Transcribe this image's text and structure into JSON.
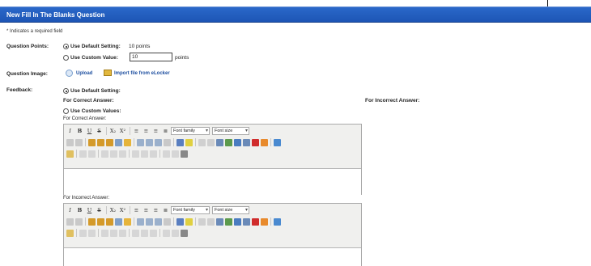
{
  "header": {
    "title": "New Fill In The Blanks Question"
  },
  "required_note": "* Indicates a required field",
  "question_points": {
    "label": "Question Points:",
    "default_label": "Use Default Setting:",
    "default_value": "10 points",
    "custom_label": "Use Custom Value:",
    "custom_value": "10",
    "custom_unit": "points"
  },
  "question_image": {
    "label": "Question Image:",
    "upload": "Upload",
    "import": "Import file from eLocker"
  },
  "feedback": {
    "label": "Feedback:",
    "default_label": "Use Default Setting:",
    "correct_heading": "For Correct Answer:",
    "incorrect_heading": "For Incorrect Answer:",
    "custom_label": "Use Custom Values:",
    "correct_editor_label": "For Correct Answer:",
    "incorrect_editor_label": "For Incorrect Answer:"
  },
  "editor": {
    "bold": "B",
    "italic": "I",
    "underline": "U",
    "strike": "S",
    "sub": "X₂",
    "sup": "X²",
    "font_family": "Font family",
    "font_size": "Font size"
  },
  "colors": {
    "header": "#1d55b5",
    "link": "#1e4fa0"
  }
}
